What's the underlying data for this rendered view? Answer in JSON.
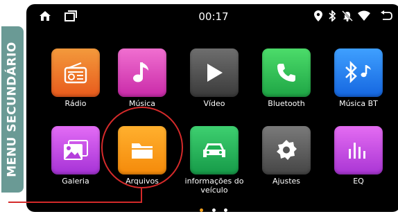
{
  "side_label": "MENU SECUNDÁRIO",
  "status": {
    "time": "00:17",
    "left_icons": [
      "home-icon",
      "recent-apps-icon"
    ],
    "right_icons": [
      "location-icon",
      "bluetooth-icon",
      "mute-icon",
      "wifi-icon",
      "back-icon"
    ]
  },
  "apps": [
    {
      "label": "Rádio",
      "icon": "radio-icon",
      "color_top": "#f39a3c",
      "color_bottom": "#e85a1c"
    },
    {
      "label": "Música",
      "icon": "music-note-icon",
      "color_top": "#f06fd0",
      "color_bottom": "#c92aa8"
    },
    {
      "label": "Vídeo",
      "icon": "play-icon",
      "color_top": "#6e6e6e",
      "color_bottom": "#3a3a3a"
    },
    {
      "label": "Bluetooth",
      "icon": "phone-icon",
      "color_top": "#4cdc6a",
      "color_bottom": "#1ea545"
    },
    {
      "label": "Música BT",
      "icon": "bluetooth-music-icon",
      "color_top": "#3fa0ff",
      "color_bottom": "#1566e0"
    },
    {
      "label": "Galeria",
      "icon": "gallery-icon",
      "color_top": "#e36cf5",
      "color_bottom": "#a532d6"
    },
    {
      "label": "Arquivos",
      "icon": "folder-icon",
      "color_top": "#ffb02e",
      "color_bottom": "#f58a0a"
    },
    {
      "label": "informações do veículo",
      "icon": "car-icon",
      "color_top": "#3ed070",
      "color_bottom": "#169a48"
    },
    {
      "label": "Ajustes",
      "icon": "settings-gear-icon",
      "color_top": "#7a7a7a",
      "color_bottom": "#454545"
    },
    {
      "label": "EQ",
      "icon": "equalizer-icon",
      "color_top": "#e46cf2",
      "color_bottom": "#a935d4"
    }
  ],
  "page_indicator": {
    "pages": 3,
    "current": 1,
    "active_color": "#f0a020",
    "inactive_color": "#ffffff"
  },
  "highlight_color": "#d42a2a"
}
